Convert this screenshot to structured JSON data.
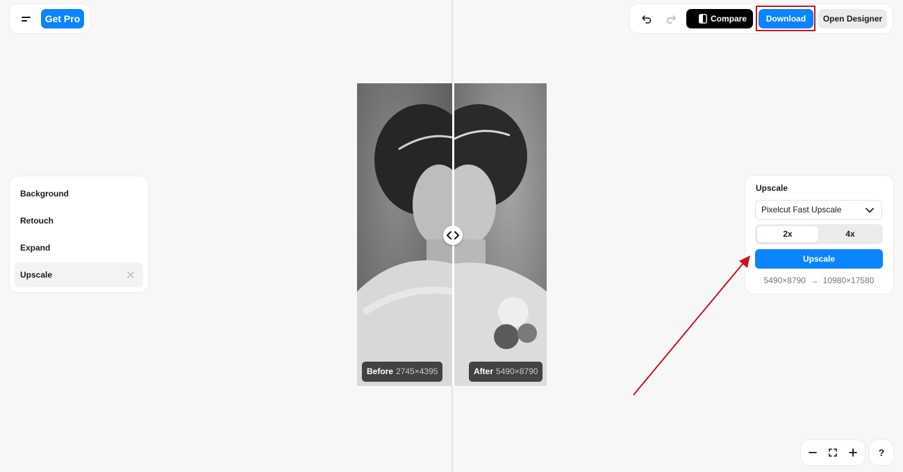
{
  "header": {
    "get_pro_label": "Get Pro",
    "menu_icon": "menu-icon"
  },
  "toolbar": {
    "undo_icon": "undo-icon",
    "redo_icon": "redo-icon",
    "compare_label": "Compare",
    "download_label": "Download",
    "open_designer_label": "Open Designer"
  },
  "image": {
    "before_label": "Before",
    "before_size": "2745×4395",
    "after_label": "After",
    "after_size": "5490×8790",
    "handle_icon": "chevrons-left-right-icon"
  },
  "sidebar": {
    "items": [
      {
        "label": "Background",
        "active": false
      },
      {
        "label": "Retouch",
        "active": false
      },
      {
        "label": "Expand",
        "active": false
      },
      {
        "label": "Upscale",
        "active": true
      }
    ]
  },
  "upscale_panel": {
    "title": "Upscale",
    "model": "Pixelcut Fast Upscale",
    "options": [
      "2x",
      "4x"
    ],
    "selected_option": "2x",
    "button_label": "Upscale",
    "from_resolution": "5490×8790",
    "to_resolution": "10980×17580"
  },
  "zoom_controls": {
    "zoom_out_icon": "minus-icon",
    "fit_icon": "fullscreen-icon",
    "zoom_in_icon": "plus-icon",
    "help_label": "?"
  },
  "colors": {
    "accent": "#0a84ff",
    "annotation": "#d0111b",
    "background": "#f7f7f7"
  }
}
